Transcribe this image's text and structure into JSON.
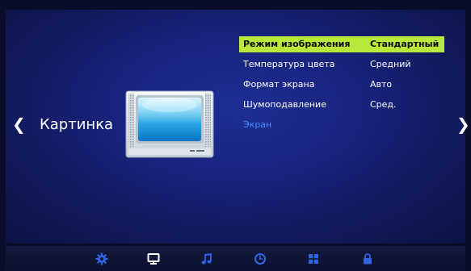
{
  "navigation": {
    "prev_icon": "chevron-left-icon",
    "prev_glyph": "❮",
    "next_icon": "chevron-right-icon",
    "next_glyph": "❯"
  },
  "section": {
    "title": "Картинка",
    "icon": "tv-icon"
  },
  "menu": {
    "items": [
      {
        "label": "Режим изображения",
        "value": "Стандартный",
        "state": "selected"
      },
      {
        "label": "Температура цвета",
        "value": "Средний",
        "state": "normal"
      },
      {
        "label": "Формат экрана",
        "value": "Авто",
        "state": "normal"
      },
      {
        "label": "Шумоподавление",
        "value": "Сред.",
        "state": "normal"
      },
      {
        "label": "Экран",
        "value": "",
        "state": "disabled"
      }
    ]
  },
  "bottom_bar": {
    "icons": [
      {
        "name": "settings-gear-icon",
        "active": false
      },
      {
        "name": "picture-monitor-icon",
        "active": true
      },
      {
        "name": "sound-music-icon",
        "active": false
      },
      {
        "name": "time-clock-icon",
        "active": false
      },
      {
        "name": "options-grid-icon",
        "active": false
      },
      {
        "name": "lock-icon",
        "active": false
      }
    ]
  },
  "colors": {
    "highlight": "#b8e83a",
    "disabled_text": "#4a8cff",
    "icon_inactive": "#2f66e6",
    "icon_active": "#ffffff"
  }
}
